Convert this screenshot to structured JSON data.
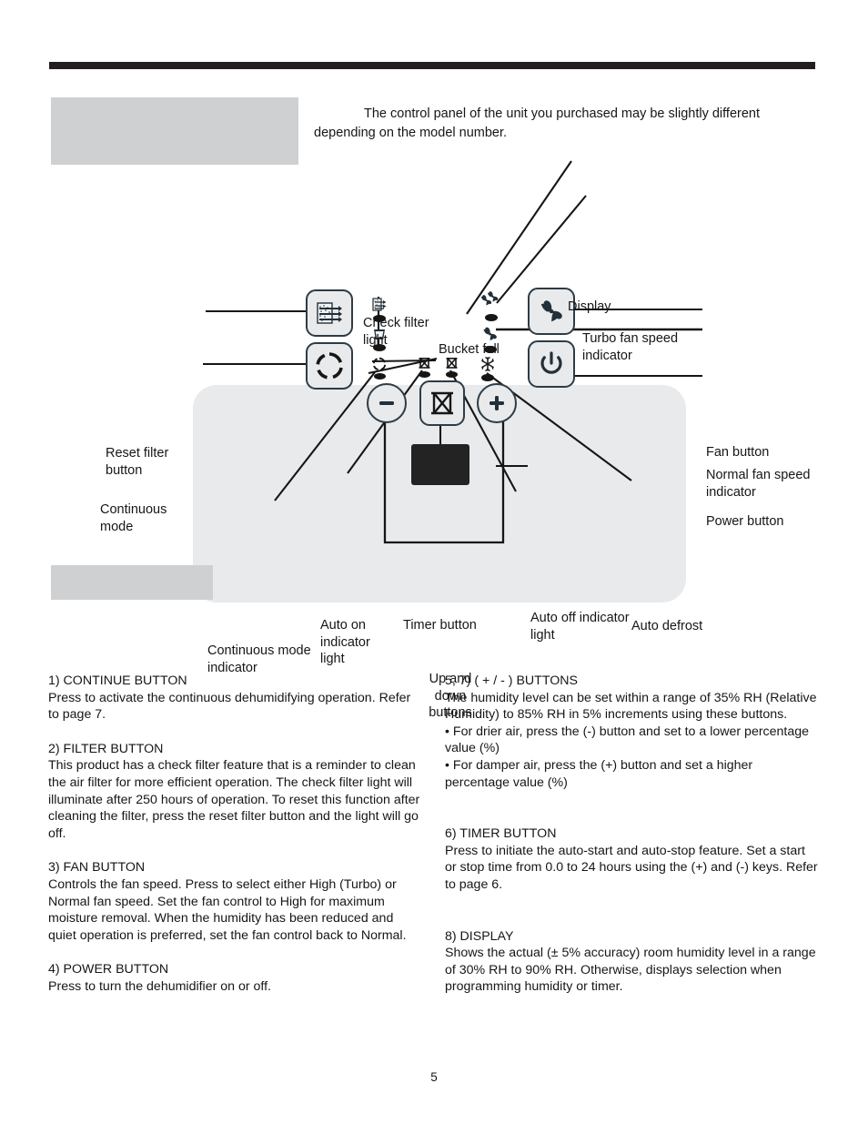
{
  "intro": {
    "text": "The control panel of the unit you purchased may be slightly different depending on the model number."
  },
  "diagram": {
    "labels": {
      "check_filter_light": "Check filter light",
      "bucket_full": "Bucket full",
      "display": "Display",
      "turbo_fan_speed_indicator": "Turbo fan speed indicator",
      "reset_filter_button": "Reset filter button",
      "continuous_mode": "Continuous mode",
      "fan_button": "Fan button",
      "normal_fan_speed_indicator": "Normal fan speed indicator",
      "power_button": "Power button",
      "continuous_mode_indicator": "Continuous mode indicator",
      "auto_on_indicator_light": "Auto on indicator light",
      "timer_button": "Timer button",
      "up_and_down_buttons": "Up and down buttons",
      "auto_off_indicator_light": "Auto off indicator light",
      "auto_defrost": "Auto defrost"
    },
    "colors": {
      "panel_face": "#e9eaec",
      "key_outline": "#2d3c46",
      "lcd": "#232323",
      "led": "#161616",
      "redaction": "#cfd0d2",
      "rule": "#231f20"
    }
  },
  "sections": {
    "left": [
      {
        "heading": "1)  CONTINUE BUTTON",
        "body": "Press to activate the continuous dehumidifying operation. Refer to page 7."
      },
      {
        "heading": "2) FILTER BUTTON",
        "body": "This product has a check filter feature that is a reminder to clean the air filter for more efficient operation. The check filter light will illuminate after 250 hours of operation. To reset this function after cleaning the filter, press the reset filter button and the light will go off."
      },
      {
        "heading": "3) FAN BUTTON",
        "body": "Controls the fan speed. Press to select either High (Turbo) or Normal fan speed. Set the fan control to High for maximum moisture removal. When the humidity has been reduced and quiet operation is preferred, set the fan control back to Normal."
      },
      {
        "heading": "4) POWER BUTTON",
        "body": "Press to turn the dehumidifier on or off."
      }
    ],
    "right": [
      {
        "heading": "5, 7) ( + / - ) BUTTONS",
        "body": "The humidity level can be set within a range of 35% RH (Relative Humidity) to 85% RH in 5% increments using these buttons.",
        "bullets": [
          "• For drier air, press the (-) button and set to a lower percentage value (%)",
          "• For damper air, press the (+) button and set a higher percentage value (%)"
        ]
      },
      {
        "heading": "6) TIMER BUTTON",
        "body": "Press to initiate the auto-start and auto-stop feature. Set a start or stop time from 0.0 to 24 hours using the (+) and (-) keys. Refer to page 6."
      },
      {
        "heading": "8) DISPLAY",
        "body": "Shows the actual (± 5% accuracy) room humidity level in a range of 30% RH to 90% RH. Otherwise, displays selection when programming humidity or timer."
      }
    ]
  },
  "footer": {
    "page_number": "5"
  }
}
